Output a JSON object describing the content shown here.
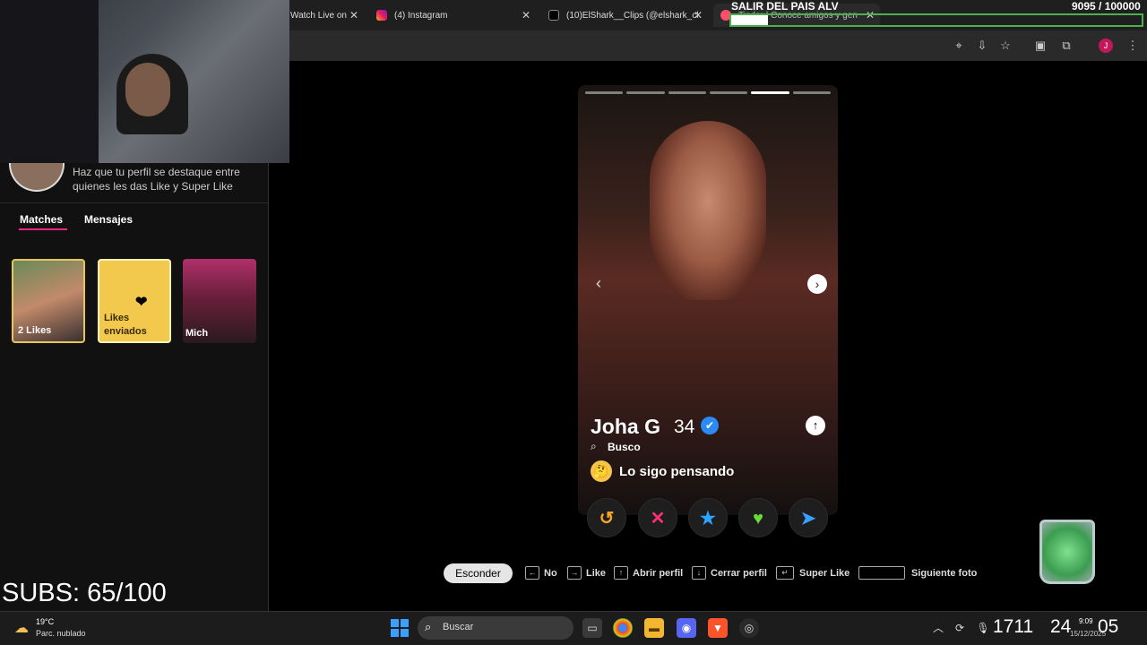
{
  "browser": {
    "tabs": [
      {
        "label": "Watch Live on",
        "icon": "tab-icon"
      },
      {
        "label": "(4) Instagram",
        "icon": "instagram-icon"
      },
      {
        "label": "(10)ElShark__Clips (@elshark_cl",
        "icon": "tiktok-icon"
      },
      {
        "label": "Tinder | Conoce amigos y gen",
        "icon": "tinder-icon"
      }
    ]
  },
  "overlay": {
    "goal_title": "SALIR DEL PAIS ALV",
    "goal_count": "9095 / 100000",
    "goal_progress": 0.09,
    "subs": "SUBS: 65/100"
  },
  "sidebar": {
    "promo_text": "Haz que tu perfil se destaque entre quienes les das Like y Super Like",
    "tabs": [
      "Matches",
      "Mensajes"
    ],
    "active_tab": "Matches",
    "cards": [
      {
        "label": "2 Likes"
      },
      {
        "label": "Likes enviados"
      },
      {
        "label": "Mich"
      }
    ]
  },
  "profile": {
    "name": "Joha G",
    "age": "34",
    "busco_label": "Busco",
    "status": "Lo sigo pensando",
    "photo_count": 6,
    "active_photo": 5
  },
  "actions": [
    "rewind",
    "nope",
    "super-like",
    "like",
    "boost"
  ],
  "shortcuts": {
    "hide": "Esconder",
    "items": [
      {
        "key": "←",
        "label": "No"
      },
      {
        "key": "→",
        "label": "Like"
      },
      {
        "key": "↑",
        "label": "Abrir perfil"
      },
      {
        "key": "↓",
        "label": "Cerrar perfil"
      },
      {
        "key": "↵",
        "label": "Super Like"
      },
      {
        "key": "",
        "label": "Siguiente foto"
      }
    ]
  },
  "taskbar": {
    "weather_temp": "19°C",
    "weather_cond": "Parc. nublado",
    "search_label": "Buscar",
    "clock_hours": "1711",
    "clock_minutes": "24",
    "clock_seconds": "05",
    "tray_time": "9:09",
    "tray_date": "15/12/2025"
  },
  "colors": {
    "accent": "#fd267a",
    "goal_border": "#4caf50",
    "like": "#6bdb3a",
    "nope": "#ff2f7a",
    "super_like": "#2ea3ff",
    "rewind": "#f5a623",
    "boost": "#3aa0ff"
  }
}
